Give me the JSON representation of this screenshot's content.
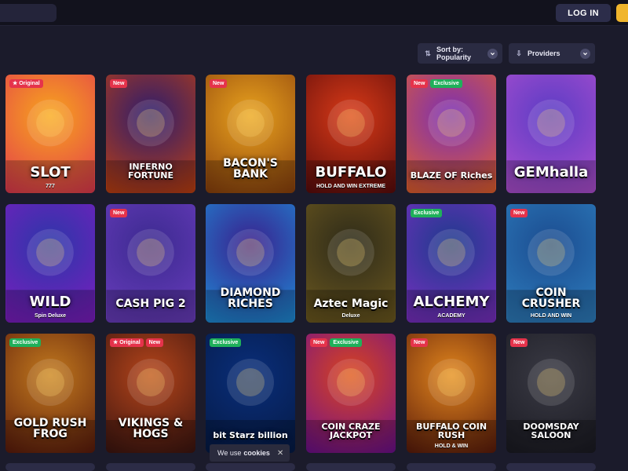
{
  "header": {
    "login_label": "LOG IN"
  },
  "filters": {
    "sort_label": "Sort by: Popularity",
    "providers_label": "Providers"
  },
  "games": [
    {
      "title": "SLOT",
      "subtitle": "777",
      "badges": [
        "Original"
      ],
      "bg1": "#f7a51d",
      "bg2": "#e2384f"
    },
    {
      "title": "INFERNO FORTUNE",
      "badges": [
        "New"
      ],
      "bg1": "#2b1c6e",
      "bg2": "#c1400f"
    },
    {
      "title": "BACON'S BANK",
      "badges": [
        "New"
      ],
      "bg1": "#e9a31e",
      "bg2": "#8a3f0c"
    },
    {
      "title": "BUFFALO",
      "subtitle": "HOLD AND WIN EXTREME",
      "badges": [],
      "bg1": "#d93a17",
      "bg2": "#5a0b0b"
    },
    {
      "title": "BLAZE OF Riches",
      "badges": [
        "New",
        "Exclusive"
      ],
      "bg1": "#7a2fb5",
      "bg2": "#e5602a"
    },
    {
      "title": "GEMhalla",
      "badges": [],
      "bg1": "#5a3cc4",
      "bg2": "#b04fd0"
    },
    {
      "title": "WILD",
      "subtitle": "Spin Deluxe",
      "badges": [],
      "bg1": "#2b37a8",
      "bg2": "#7e1cc0"
    },
    {
      "title": "CASH PIG 2",
      "badges": [
        "New"
      ],
      "bg1": "#3b2a8f",
      "bg2": "#6b3dbf"
    },
    {
      "title": "DIAMOND RICHES",
      "badges": [],
      "bg1": "#3a1f8c",
      "bg2": "#1d8ed8"
    },
    {
      "title": "Aztec Magic",
      "subtitle": "Deluxe",
      "badges": [],
      "bg1": "#2d2a19",
      "bg2": "#6e5a1f"
    },
    {
      "title": "ALCHEMY",
      "subtitle": "ACADEMY",
      "badges": [
        "Exclusive"
      ],
      "bg1": "#1d3b8c",
      "bg2": "#7b2ec2"
    },
    {
      "title": "COIN CRUSHER",
      "subtitle": "HOLD AND WIN",
      "badges": [
        "New"
      ],
      "bg1": "#1b4b8f",
      "bg2": "#2e7fbf"
    },
    {
      "title": "GOLD RUSH FROG",
      "badges": [
        "Exclusive"
      ],
      "bg1": "#c27a1e",
      "bg2": "#5b1a0b"
    },
    {
      "title": "VIKINGS & HOGS",
      "badges": [
        "Original",
        "New"
      ],
      "bg1": "#b5451a",
      "bg2": "#3b1410"
    },
    {
      "title": "bit Starz billion",
      "badges": [
        "Exclusive"
      ],
      "bg1": "#0a2e7a",
      "bg2": "#051a45"
    },
    {
      "title": "COIN CRAZE JACKPOT",
      "badges": [
        "New",
        "Exclusive"
      ],
      "bg1": "#d9441d",
      "bg2": "#6d0f8f"
    },
    {
      "title": "BUFFALO COIN RUSH",
      "subtitle": "HOLD & WIN",
      "badges": [
        "New"
      ],
      "bg1": "#e1861d",
      "bg2": "#5a1a0a"
    },
    {
      "title": "DOOMSDAY SALOON",
      "badges": [
        "New"
      ],
      "bg1": "#3a3a44",
      "bg2": "#1a1a22"
    }
  ],
  "cookie": {
    "prefix": "We use",
    "link": "cookies",
    "close": "✕"
  },
  "colors": {
    "background": "#1b1b2b",
    "topbar": "#12121d",
    "accent": "#f0b52c",
    "badge_new": "#e5334b",
    "badge_exclusive": "#1fb05a"
  }
}
